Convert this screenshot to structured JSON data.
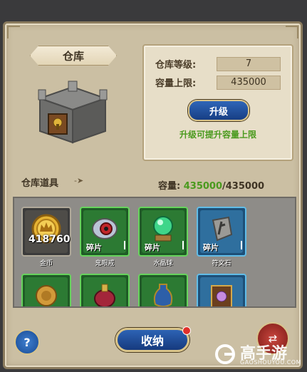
{
  "header": {
    "title": "仓库"
  },
  "info": {
    "level_label": "仓库等级:",
    "level_value": "7",
    "limit_label": "容量上限:",
    "limit_value": "435000",
    "upgrade_label": "升级",
    "upgrade_hint": "升级可提升容量上限"
  },
  "storage": {
    "title": "仓库道具",
    "capacity_label": "容量:",
    "capacity_current": "435000",
    "capacity_max": "/435000"
  },
  "items": [
    {
      "name": "金币",
      "count": "418760",
      "quality": "gray",
      "icon": "gold-coin-icon"
    },
    {
      "name": "鬼眼戒",
      "tag": "碎片",
      "quality": "green",
      "icon": "eye-ring-icon"
    },
    {
      "name": "水晶球",
      "tag": "碎片",
      "quality": "green",
      "icon": "crystal-ball-icon"
    },
    {
      "name": "符文石",
      "tag": "碎片",
      "quality": "blue",
      "icon": "rune-stone-icon"
    },
    {
      "name": "",
      "quality": "green",
      "icon": "wax-seal-icon"
    },
    {
      "name": "",
      "quality": "green",
      "icon": "potion-icon"
    },
    {
      "name": "",
      "quality": "green",
      "icon": "vase-icon"
    },
    {
      "name": "",
      "quality": "blue",
      "icon": "rune-book-icon"
    }
  ],
  "footer": {
    "help_label": "?",
    "store_label": "收纳"
  },
  "watermark": {
    "name": "高手游",
    "domain": "GAOSHOUYOU.COM"
  },
  "colors": {
    "accent_green": "#4a9a1e",
    "button_blue": "#1f4f9a",
    "panel_bg": "#cbbfa3"
  }
}
